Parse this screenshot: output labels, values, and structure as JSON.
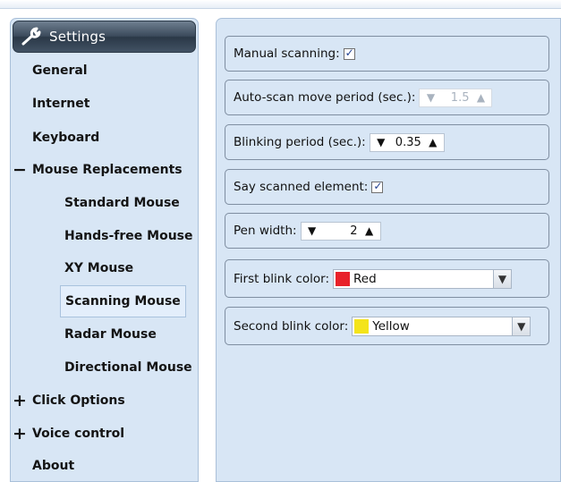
{
  "sidebar": {
    "title": "Settings",
    "items": [
      {
        "label": "General",
        "prefix": ""
      },
      {
        "label": "Internet",
        "prefix": ""
      },
      {
        "label": "Keyboard",
        "prefix": ""
      },
      {
        "label": "Mouse Replacements",
        "prefix": "−"
      },
      {
        "label": "Standard Mouse",
        "prefix": ""
      },
      {
        "label": "Hands-free Mouse",
        "prefix": ""
      },
      {
        "label": "XY Mouse",
        "prefix": ""
      },
      {
        "label": "Scanning Mouse",
        "prefix": "",
        "selected": true
      },
      {
        "label": "Radar Mouse",
        "prefix": ""
      },
      {
        "label": "Directional Mouse",
        "prefix": ""
      },
      {
        "label": "Click Options",
        "prefix": "+"
      },
      {
        "label": "Voice control",
        "prefix": "+"
      },
      {
        "label": "About",
        "prefix": ""
      }
    ]
  },
  "settings": {
    "manual_scanning": {
      "label": "Manual scanning:",
      "checked": true,
      "check_glyph": "✓"
    },
    "autoscan": {
      "label": "Auto-scan move period (sec.):",
      "down": "▼",
      "value": "1.5",
      "up": "▲",
      "enabled": false
    },
    "blinking": {
      "label": "Blinking period (sec.):",
      "down": "▼",
      "value": "0.35",
      "up": "▲"
    },
    "say_scanned": {
      "label": "Say scanned element:",
      "checked": true,
      "check_glyph": "✓"
    },
    "pen_width": {
      "label": "Pen width:",
      "down": "▼",
      "value": "2",
      "up": "▲"
    },
    "first_blink": {
      "label": "First blink color:",
      "value": "Red",
      "color": "#e8212a",
      "dropdown": "▼"
    },
    "second_blink": {
      "label": "Second blink color:",
      "value": "Yellow",
      "color": "#f4e41a",
      "dropdown": "▼"
    }
  },
  "colors": {
    "panel_bg": "#d8e6f5",
    "header_dark": "#3b4a5b"
  }
}
